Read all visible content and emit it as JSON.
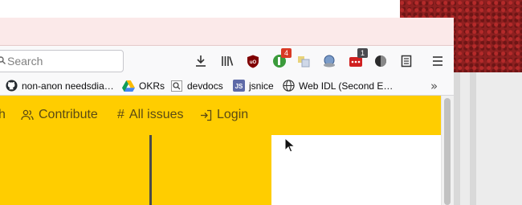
{
  "window": {
    "type": "browser"
  },
  "search": {
    "placeholder": "Search"
  },
  "toolbar": {
    "items": [
      {
        "name": "downloads-icon"
      },
      {
        "name": "library-icon"
      },
      {
        "name": "ublock-icon"
      },
      {
        "name": "extension-green-icon",
        "badge": "4"
      },
      {
        "name": "extension-tiles-icon"
      },
      {
        "name": "extension-globe-icon"
      },
      {
        "name": "extension-red-icon",
        "badge": "1"
      },
      {
        "name": "extension-dark-icon"
      },
      {
        "name": "reader-icon"
      },
      {
        "name": "menu-icon"
      }
    ]
  },
  "bookmarks": {
    "items": [
      {
        "icon": "github-icon",
        "label": "non-anon needsdia…"
      },
      {
        "icon": "google-drive-icon",
        "label": "OKRs"
      },
      {
        "icon": "search-icon",
        "label": "devdocs"
      },
      {
        "icon": "js-icon",
        "label": "jsnice"
      },
      {
        "icon": "globe-icon",
        "label": "Web IDL (Second E…"
      }
    ],
    "overflow_icon": "chevron-double-right-icon"
  },
  "page": {
    "nav": [
      {
        "icon": "",
        "label": "h"
      },
      {
        "icon": "users-icon",
        "label": "Contribute"
      },
      {
        "icon": "hash-icon",
        "label": "All issues"
      },
      {
        "icon": "login-icon",
        "label": "Login"
      }
    ]
  },
  "colors": {
    "accent_yellow": "#ffcd00",
    "titlebar_pink": "#fbe9e9",
    "nav_text": "#5a4a14",
    "desktop_red": "#8e2020"
  }
}
